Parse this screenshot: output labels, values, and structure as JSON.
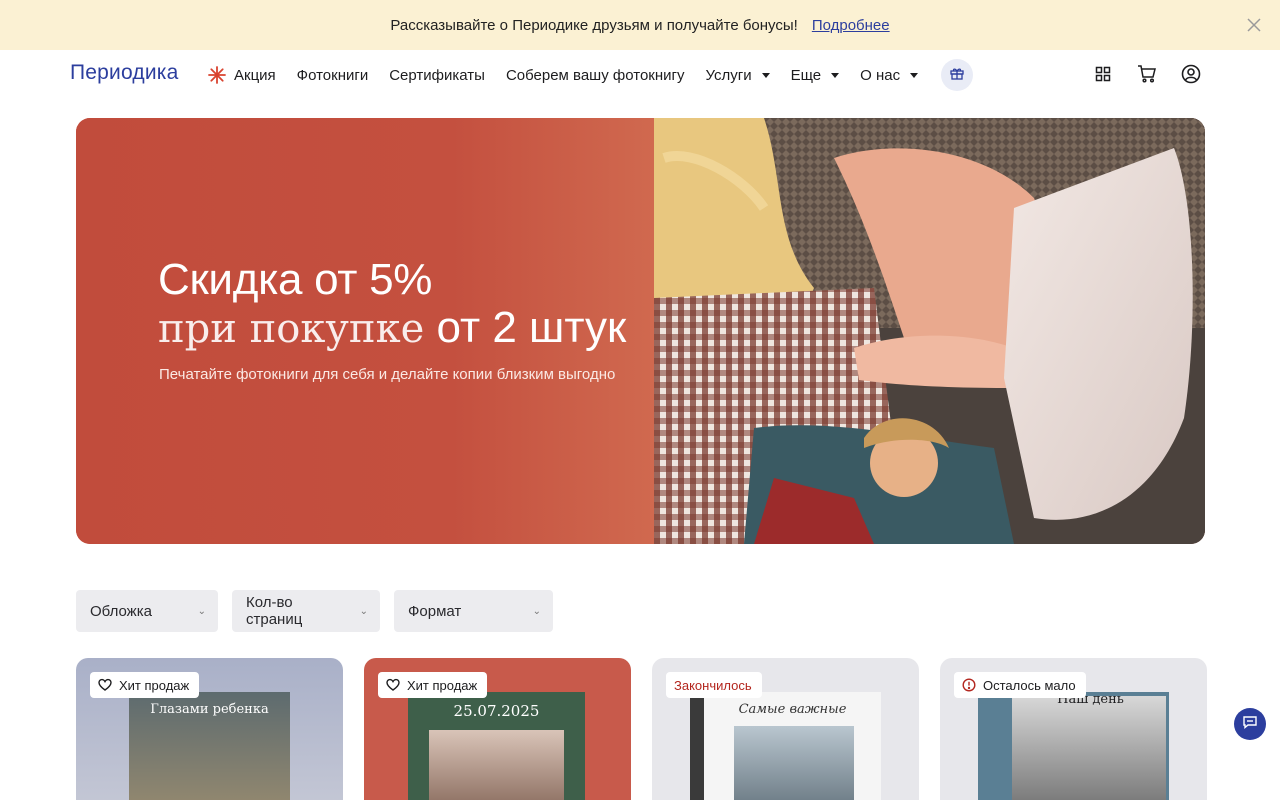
{
  "promo": {
    "text": "Рассказывайте о Периодике друзьям и получайте бонусы!",
    "link": "Подробнее"
  },
  "header": {
    "logo": "Периодика",
    "nav": [
      {
        "label": "Акция"
      },
      {
        "label": "Фотокниги"
      },
      {
        "label": "Сертификаты"
      },
      {
        "label": "Соберем вашу фотокнигу"
      },
      {
        "label": "Услуги"
      },
      {
        "label": "Еще"
      },
      {
        "label": "О нас"
      }
    ]
  },
  "hero": {
    "title_line1": "Скидка от 5%",
    "title_line2_serif": "при покупке",
    "title_line2_strong": "от 2 штук",
    "subtitle": "Печатайте фотокниги для себя и делайте копии близким выгодно"
  },
  "filters": [
    {
      "label": "Обложка"
    },
    {
      "label": "Кол-во страниц"
    },
    {
      "label": "Формат"
    }
  ],
  "products": [
    {
      "badge": "Хит продаж",
      "badge_icon": "heart-icon",
      "cover_title": "Глазами ребенка"
    },
    {
      "badge": "Хит продаж",
      "badge_icon": "heart-icon",
      "cover_title": "25.07.2025"
    },
    {
      "badge": "Закончилось",
      "badge_icon": "",
      "cover_title": "Самые важные"
    },
    {
      "badge": "Осталось мало",
      "badge_icon": "alert-circle-icon",
      "cover_title": "Наш день"
    }
  ],
  "colors": {
    "brand": "#2c3e9e",
    "promo_bg": "#fbf1d3",
    "hero_red": "#c4503f",
    "accent_star": "#d9432f"
  }
}
